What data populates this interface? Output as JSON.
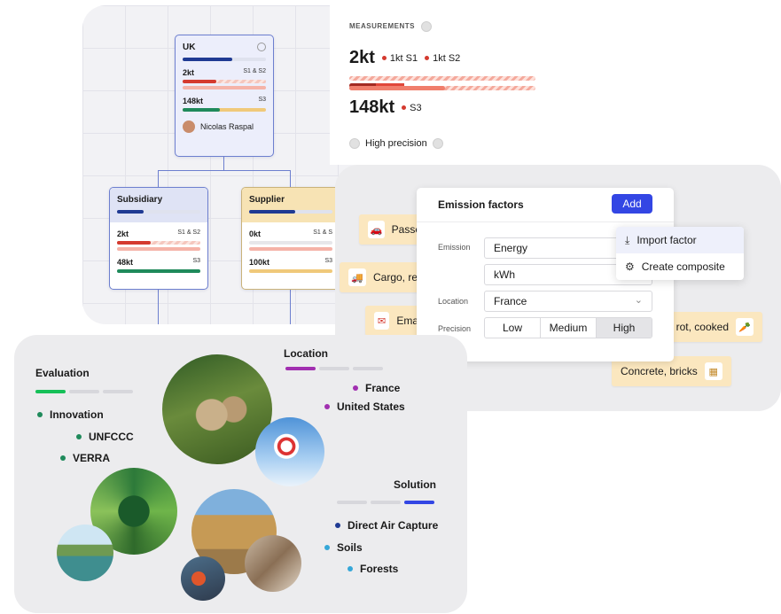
{
  "org": {
    "root": {
      "name": "UK",
      "m1": "2kt",
      "m1_tag": "S1 & S2",
      "m2": "148kt",
      "m2_tag": "S3",
      "person": "Nicolas Raspal"
    },
    "subsidiary": {
      "name": "Subsidiary",
      "m1": "2kt",
      "m1_tag": "S1 & S2",
      "m2": "48kt",
      "m2_tag": "S3"
    },
    "supplier": {
      "name": "Supplier",
      "m1": "0kt",
      "m1_tag": "S1 & S",
      "m2": "100kt",
      "m2_tag": "S3"
    }
  },
  "measurements": {
    "label": "MEASUREMENTS",
    "total1": "2kt",
    "s1": "1kt S1",
    "s2": "1kt S2",
    "total2": "148kt",
    "s3": "S3",
    "precision": "High precision"
  },
  "emission": {
    "title": "Emission factors",
    "add_label": "Add",
    "fields": [
      {
        "label": "Emission",
        "value": "Energy"
      },
      {
        "label": "",
        "value": "kWh"
      },
      {
        "label": "Location",
        "value": "France"
      }
    ],
    "precision_label": "Precision",
    "precision_options": [
      "Low",
      "Medium",
      "High"
    ],
    "precision_selected": "High",
    "menu": [
      "Import factor",
      "Create composite"
    ],
    "chips": [
      "Passe",
      "Cargo, refrigerated",
      "Ema",
      "rot, cooked",
      "Concrete, bricks"
    ]
  },
  "portfolio": {
    "evaluation": {
      "title": "Evaluation",
      "items": [
        "Innovation",
        "UNFCCC",
        "VERRA"
      ]
    },
    "location": {
      "title": "Location",
      "items": [
        "France",
        "United States"
      ]
    },
    "solution": {
      "title": "Solution",
      "items": [
        "Direct Air Capture",
        "Soils",
        "Forests"
      ]
    }
  },
  "colors": {
    "accent": "#3346e4",
    "navy": "#1f3a93",
    "red": "#d43a2f",
    "green": "#1f8a5b",
    "purple": "#a12fb0"
  }
}
